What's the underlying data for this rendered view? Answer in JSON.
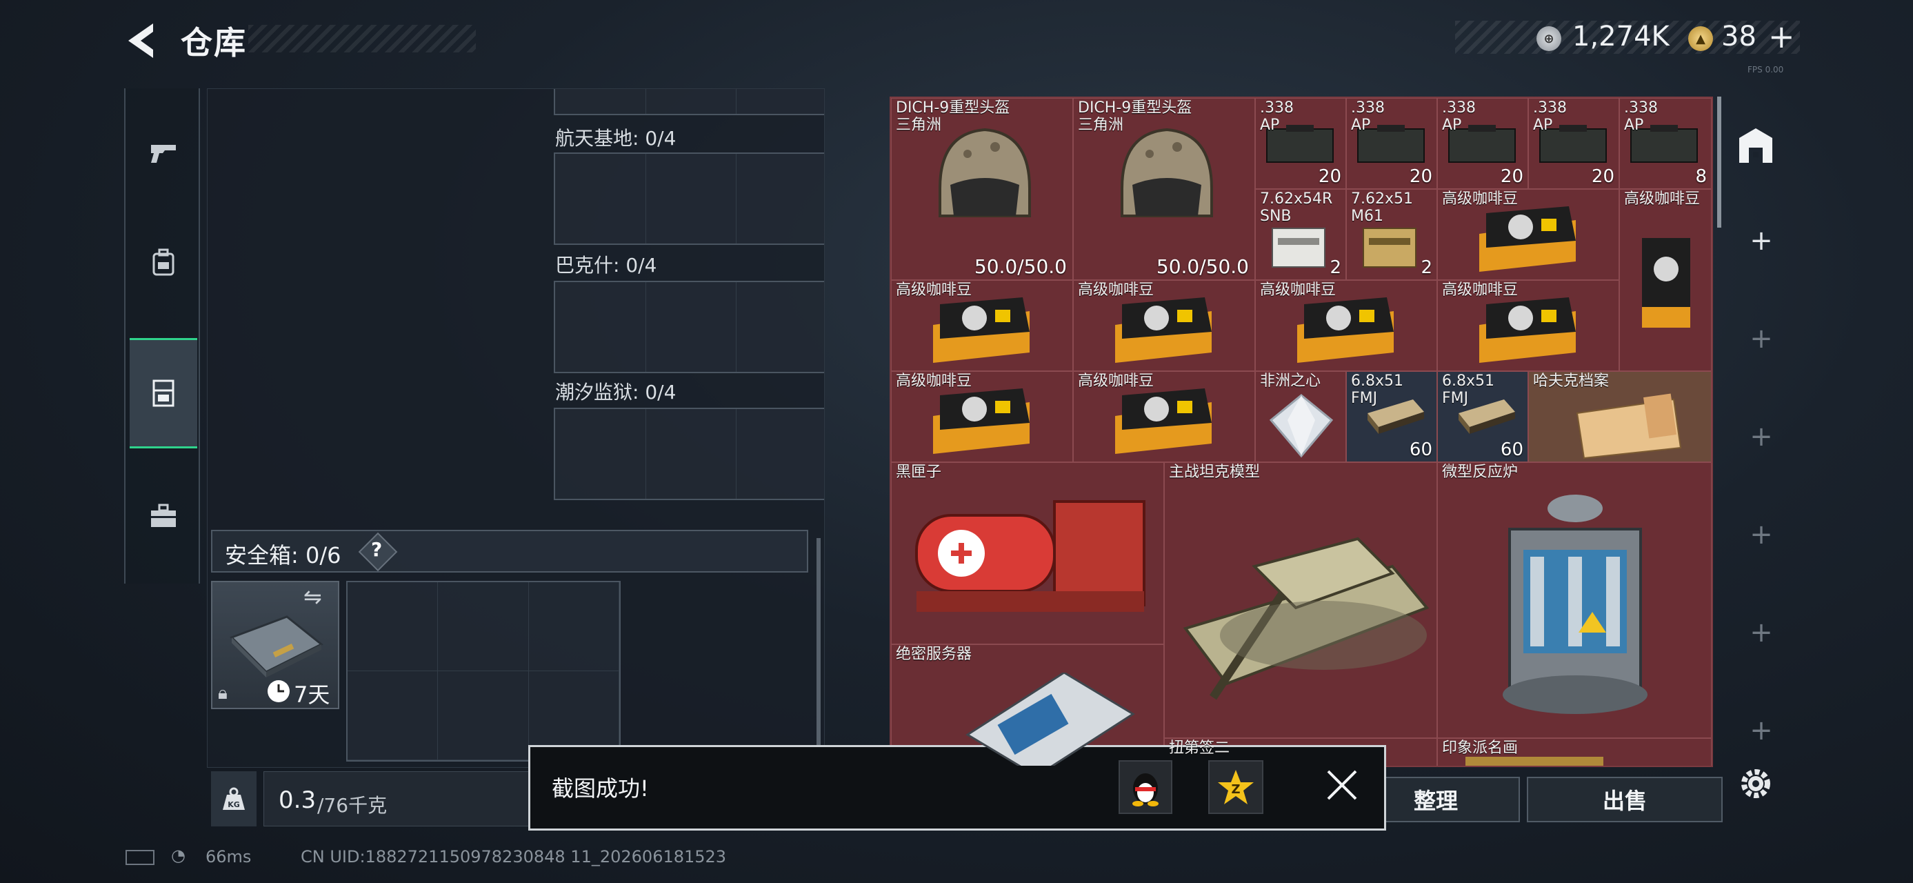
{
  "header": {
    "title": "仓库"
  },
  "currency": {
    "silver": "1,274K",
    "gold": "38",
    "gold_plus": "+"
  },
  "version_tag": "FPS 0.00",
  "slots": {
    "space_base": "航天基地: 0/4",
    "bakhmut": "巴克什: 0/4",
    "tide_prison": "潮汐监狱: 0/4"
  },
  "safebox": {
    "label": "安全箱: 0/6",
    "help": "?",
    "duration": "7天"
  },
  "weight": {
    "value": "0.3",
    "capacity": "/76千克"
  },
  "inventory": {
    "helmet1": {
      "name": "DICH-9重型头盔\n三角洲",
      "durability": "50.0/50.0"
    },
    "helmet2": {
      "name": "DICH-9重型头盔\n三角洲",
      "durability": "50.0/50.0"
    },
    "ammo338_1": {
      "name": ".338\nAP",
      "qty": "20"
    },
    "ammo338_2": {
      "name": ".338\nAP",
      "qty": "20"
    },
    "ammo338_3": {
      "name": ".338\nAP",
      "qty": "20"
    },
    "ammo338_4": {
      "name": ".338\nAP",
      "qty": "20"
    },
    "ammo338_5": {
      "name": ".338\nAP",
      "qty": "8"
    },
    "ammo762r": {
      "name": "7.62x54R\nSNB",
      "qty": "2"
    },
    "ammo762m": {
      "name": "7.62x51\nM61",
      "qty": "2"
    },
    "coffee_label": "高级咖啡豆",
    "heart": {
      "name": "非洲之心"
    },
    "ammo68_1": {
      "name": "6.8x51\nFMJ",
      "qty": "60"
    },
    "ammo68_2": {
      "name": "6.8x51\nFMJ",
      "qty": "60"
    },
    "hafk": {
      "name": "哈夫克档案"
    },
    "blackbox": {
      "name": "黑匣子"
    },
    "tank": {
      "name": "主战坦克模型"
    },
    "reactor": {
      "name": "微型反应炉"
    },
    "server": {
      "name": "绝密服务器"
    },
    "partial1": {
      "name": "扭第签二"
    },
    "painting": {
      "name": "印象派名画"
    }
  },
  "actions": {
    "sort": "整理",
    "sell": "出售"
  },
  "toast": {
    "text": "截图成功!"
  },
  "status": {
    "ping": "66ms",
    "uid": "CN UID:1882721150978230848 11_202606181523"
  },
  "colors": {
    "accent_green": "#2fd38c",
    "rare_red": "#6a2e34",
    "toast_border": "#cfd4d8"
  }
}
